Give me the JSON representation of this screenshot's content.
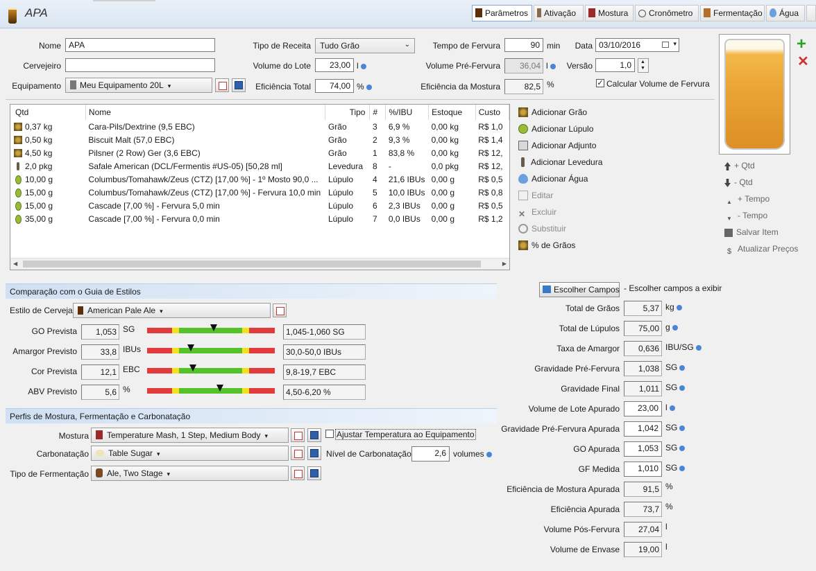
{
  "title": "APA",
  "tabs": [
    {
      "label": "Parâmetros",
      "active": true
    },
    {
      "label": "Ativação"
    },
    {
      "label": "Mostura"
    },
    {
      "label": "Cronômetro"
    },
    {
      "label": "Fermentação"
    },
    {
      "label": "Água"
    }
  ],
  "form": {
    "nome_label": "Nome",
    "nome_value": "APA",
    "cervejeiro_label": "Cervejeiro",
    "cervejeiro_value": "",
    "equipamento_label": "Equipamento",
    "equipamento_value": "Meu Equipamento 20L",
    "tipo_label": "Tipo de Receita",
    "tipo_value": "Tudo Grão",
    "volume_lote_label": "Volume do Lote",
    "volume_lote_value": "23,00",
    "volume_lote_unit": "l",
    "eficiencia_total_label": "Eficiência Total",
    "eficiencia_total_value": "74,00",
    "eficiencia_total_unit": "%",
    "tempo_fervura_label": "Tempo de Fervura",
    "tempo_fervura_value": "90",
    "tempo_fervura_unit": "min",
    "volume_pre_label": "Volume Pré-Fervura",
    "volume_pre_value": "36,04",
    "volume_pre_unit": "l",
    "eficiencia_mostura_label": "Eficiência da Mostura",
    "eficiencia_mostura_value": "82,5",
    "eficiencia_mostura_unit": "%",
    "data_label": "Data",
    "data_value": "03/10/2016",
    "versao_label": "Versão",
    "versao_value": "1,0",
    "calc_label": "Calcular Volume de Fervura",
    "calc_checked": true
  },
  "table": {
    "headers": [
      "Qtd",
      "Nome",
      "Tipo",
      "#",
      "%/IBU",
      "Estoque",
      "Custo"
    ],
    "rows": [
      {
        "qtd": "0,37 kg",
        "nome": "Cara-Pils/Dextrine (9,5 EBC)",
        "tipo": "Grão",
        "n": "3",
        "pct": "6,9 %",
        "estoque": "0,00 kg",
        "custo": "R$ 1,0",
        "icon": "grain"
      },
      {
        "qtd": "0,50 kg",
        "nome": "Biscuit Malt (57,0 EBC)",
        "tipo": "Grão",
        "n": "2",
        "pct": "9,3 %",
        "estoque": "0,00 kg",
        "custo": "R$ 1,4",
        "icon": "grain"
      },
      {
        "qtd": "4,50 kg",
        "nome": "Pilsner (2 Row) Ger (3,6 EBC)",
        "tipo": "Grão",
        "n": "1",
        "pct": "83,8 %",
        "estoque": "0,00 kg",
        "custo": "R$ 12,",
        "icon": "grain"
      },
      {
        "qtd": "2,0 pkg",
        "nome": "Safale American  (DCL/Fermentis #US-05) [50,28 ml]",
        "tipo": "Levedura",
        "n": "8",
        "pct": "-",
        "estoque": "0,0 pkg",
        "custo": "R$ 12,",
        "icon": "yeast"
      },
      {
        "qtd": "10,00 g",
        "nome": "Columbus/Tomahawk/Zeus (CTZ) [17,00 %] - 1º Mosto 90,0 ...",
        "tipo": "Lúpulo",
        "n": "4",
        "pct": "21,6 IBUs",
        "estoque": "0,00 g",
        "custo": "R$ 0,5",
        "icon": "hop"
      },
      {
        "qtd": "15,00 g",
        "nome": "Columbus/Tomahawk/Zeus (CTZ) [17,00 %] - Fervura 10,0 min",
        "tipo": "Lúpulo",
        "n": "5",
        "pct": "10,0 IBUs",
        "estoque": "0,00 g",
        "custo": "R$ 0,8",
        "icon": "hop"
      },
      {
        "qtd": "15,00 g",
        "nome": "Cascade [7,00 %] - Fervura 5,0 min",
        "tipo": "Lúpulo",
        "n": "6",
        "pct": "2,3 IBUs",
        "estoque": "0,00 g",
        "custo": "R$ 0,5",
        "icon": "hop"
      },
      {
        "qtd": "35,00 g",
        "nome": "Cascade [7,00 %] - Fervura 0,0 min",
        "tipo": "Lúpulo",
        "n": "7",
        "pct": "0,0 IBUs",
        "estoque": "0,00 g",
        "custo": "R$ 1,2",
        "icon": "hop"
      }
    ]
  },
  "actions": [
    {
      "label": "Adicionar Grão",
      "enabled": true,
      "icon": "grain-icon"
    },
    {
      "label": "Adicionar Lúpulo",
      "enabled": true,
      "icon": "hop-icon"
    },
    {
      "label": "Adicionar Adjunto",
      "enabled": true,
      "icon": "adjunct-icon"
    },
    {
      "label": "Adicionar Levedura",
      "enabled": true,
      "icon": "yeast-icon"
    },
    {
      "label": "Adicionar Água",
      "enabled": true,
      "icon": "water-drop-icon"
    },
    {
      "label": "Editar",
      "enabled": false,
      "icon": "edit-icon"
    },
    {
      "label": "Excluir",
      "enabled": false,
      "icon": "delete-icon"
    },
    {
      "label": "Substituir",
      "enabled": false,
      "icon": "replace-icon"
    },
    {
      "label": "% de Grãos",
      "enabled": true,
      "icon": "grain-percent-icon"
    }
  ],
  "right_actions": [
    {
      "label": "+ Qtd",
      "icon": "arrow-up-icon"
    },
    {
      "label": "- Qtd",
      "icon": "arrow-down-icon"
    },
    {
      "label": "+ Tempo",
      "icon": "small-up-icon"
    },
    {
      "label": "- Tempo",
      "icon": "small-down-icon"
    },
    {
      "label": "Salvar Item",
      "icon": "save-icon"
    },
    {
      "label": "Atualizar Preços",
      "icon": "dollar-icon"
    }
  ],
  "style_section": {
    "title": "Comparação com o Guia de Estilos",
    "estilo_label": "Estilo de Cerveja",
    "estilo_value": "American Pale Ale",
    "rows": [
      {
        "label": "GO Prevista",
        "value": "1,053",
        "unit": "SG",
        "range": "1,045-1,060 SG",
        "marker": 0.52
      },
      {
        "label": "Amargor Previsto",
        "value": "33,8",
        "unit": "IBUs",
        "range": "30,0-50,0 IBUs",
        "marker": 0.34
      },
      {
        "label": "Cor Prevista",
        "value": "12,1",
        "unit": "EBC",
        "range": "9,8-19,7 EBC",
        "marker": 0.36
      },
      {
        "label": "ABV Previsto",
        "value": "5,6",
        "unit": "%",
        "range": "4,50-6,20 %",
        "marker": 0.57
      }
    ]
  },
  "profiles": {
    "title": "Perfis de Mostura, Fermentação e Carbonatação",
    "mostura_label": "Mostura",
    "mostura_value": "Temperature Mash, 1 Step, Medium Body",
    "ajustar_label": "Ajustar Temperatura ao Equipamento",
    "carb_label": "Carbonatação",
    "carb_value": "Table Sugar",
    "nivel_label": "Nível de Carbonatação",
    "nivel_value": "2,6",
    "nivel_unit": "volumes",
    "ferm_label": "Tipo de Fermentação",
    "ferm_value": "Ale, Two Stage"
  },
  "stats": {
    "escolher_label": "Escolher Campos",
    "escolher_hint": "- Escolher campos a exibir",
    "rows": [
      {
        "label": "Total de Grãos",
        "value": "5,37",
        "unit": "kg",
        "dot": true,
        "editable": false
      },
      {
        "label": "Total de Lúpulos",
        "value": "75,00",
        "unit": "g",
        "dot": true,
        "editable": false
      },
      {
        "label": "Taxa de Amargor",
        "value": "0,636",
        "unit": "IBU/SG",
        "dot": true,
        "editable": false
      },
      {
        "label": "Gravidade Pré-Fervura",
        "value": "1,038",
        "unit": "SG",
        "dot": true,
        "editable": false
      },
      {
        "label": "Gravidade Final",
        "value": "1,011",
        "unit": "SG",
        "dot": true,
        "editable": false
      },
      {
        "label": "Volume de Lote Apurado",
        "value": "23,00",
        "unit": "l",
        "dot": true,
        "editable": true
      },
      {
        "label": "Gravidade Pré-Fervura Apurada",
        "value": "1,042",
        "unit": "SG",
        "dot": true,
        "editable": true
      },
      {
        "label": "GO Apurada",
        "value": "1,053",
        "unit": "SG",
        "dot": true,
        "editable": true
      },
      {
        "label": "GF Medida",
        "value": "1,010",
        "unit": "SG",
        "dot": true,
        "editable": true
      },
      {
        "label": "Eficiência de Mostura Apurada",
        "value": "91,5",
        "unit": "%",
        "dot": false,
        "editable": false
      },
      {
        "label": "Eficiência Apurada",
        "value": "73,7",
        "unit": "%",
        "dot": false,
        "editable": false
      },
      {
        "label": "Volume Pós-Fervura",
        "value": "27,04",
        "unit": "l",
        "dot": false,
        "editable": false
      },
      {
        "label": "Volume de Envase",
        "value": "19,00",
        "unit": "l",
        "dot": false,
        "editable": false
      }
    ]
  },
  "colors": {
    "accent": "#4a86d8",
    "gauge_red": "#e23b3b",
    "gauge_yellow": "#f2e21e",
    "gauge_green": "#55c22a"
  }
}
